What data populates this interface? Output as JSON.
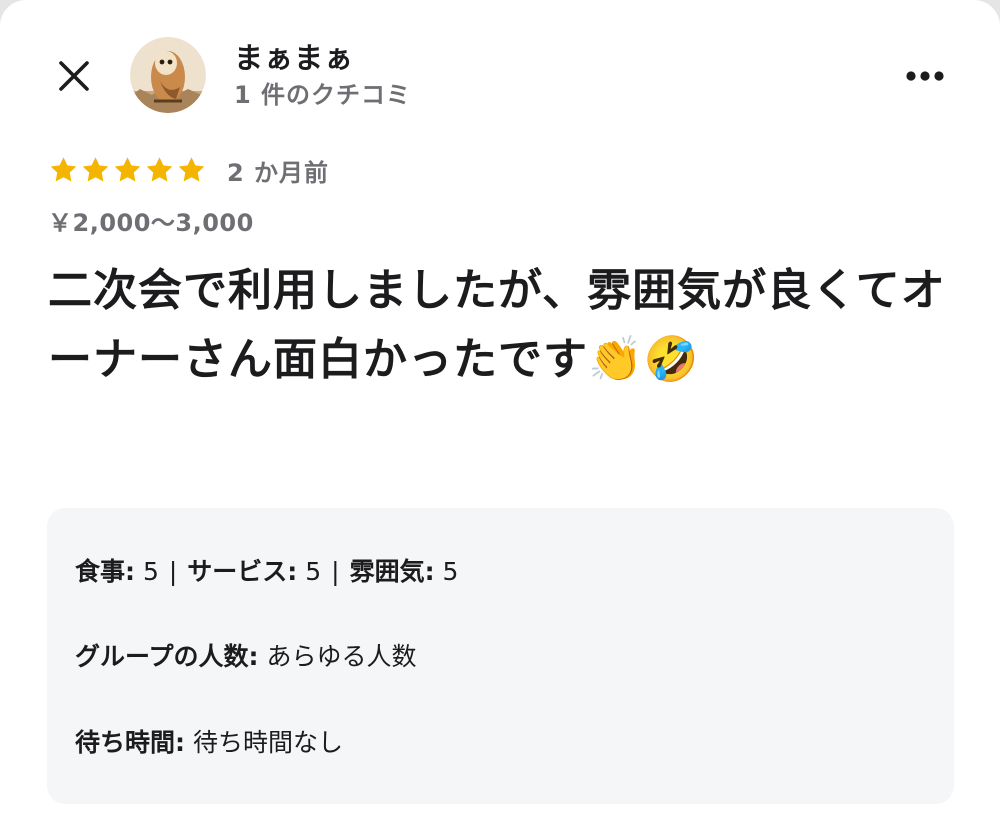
{
  "header": {
    "reviewer_name": "まぁまぁ",
    "review_count": "1 件のクチコミ"
  },
  "rating": {
    "stars": 5,
    "time_ago": "2 か月前"
  },
  "price_range": "￥2,000～3,000",
  "review": {
    "text": "二次会で利用しましたが、雰囲気が良くてオーナーさん面白かったです👏🤣"
  },
  "details": {
    "food_label": "食事:",
    "food_value": "5",
    "service_label": "サービス:",
    "service_value": "5",
    "atmosphere_label": "雰囲気:",
    "atmosphere_value": "5",
    "separator": "|",
    "group_label": "グループの人数:",
    "group_value": "あらゆる人数",
    "wait_label": "待ち時間:",
    "wait_value": "待ち時間なし"
  },
  "icons": {
    "close": "close-icon",
    "more": "more-horizontal-icon",
    "star": "star-icon"
  },
  "colors": {
    "star": "#f5b400",
    "secondary_text": "#6e6e73",
    "card_bg": "#f5f6f8"
  }
}
